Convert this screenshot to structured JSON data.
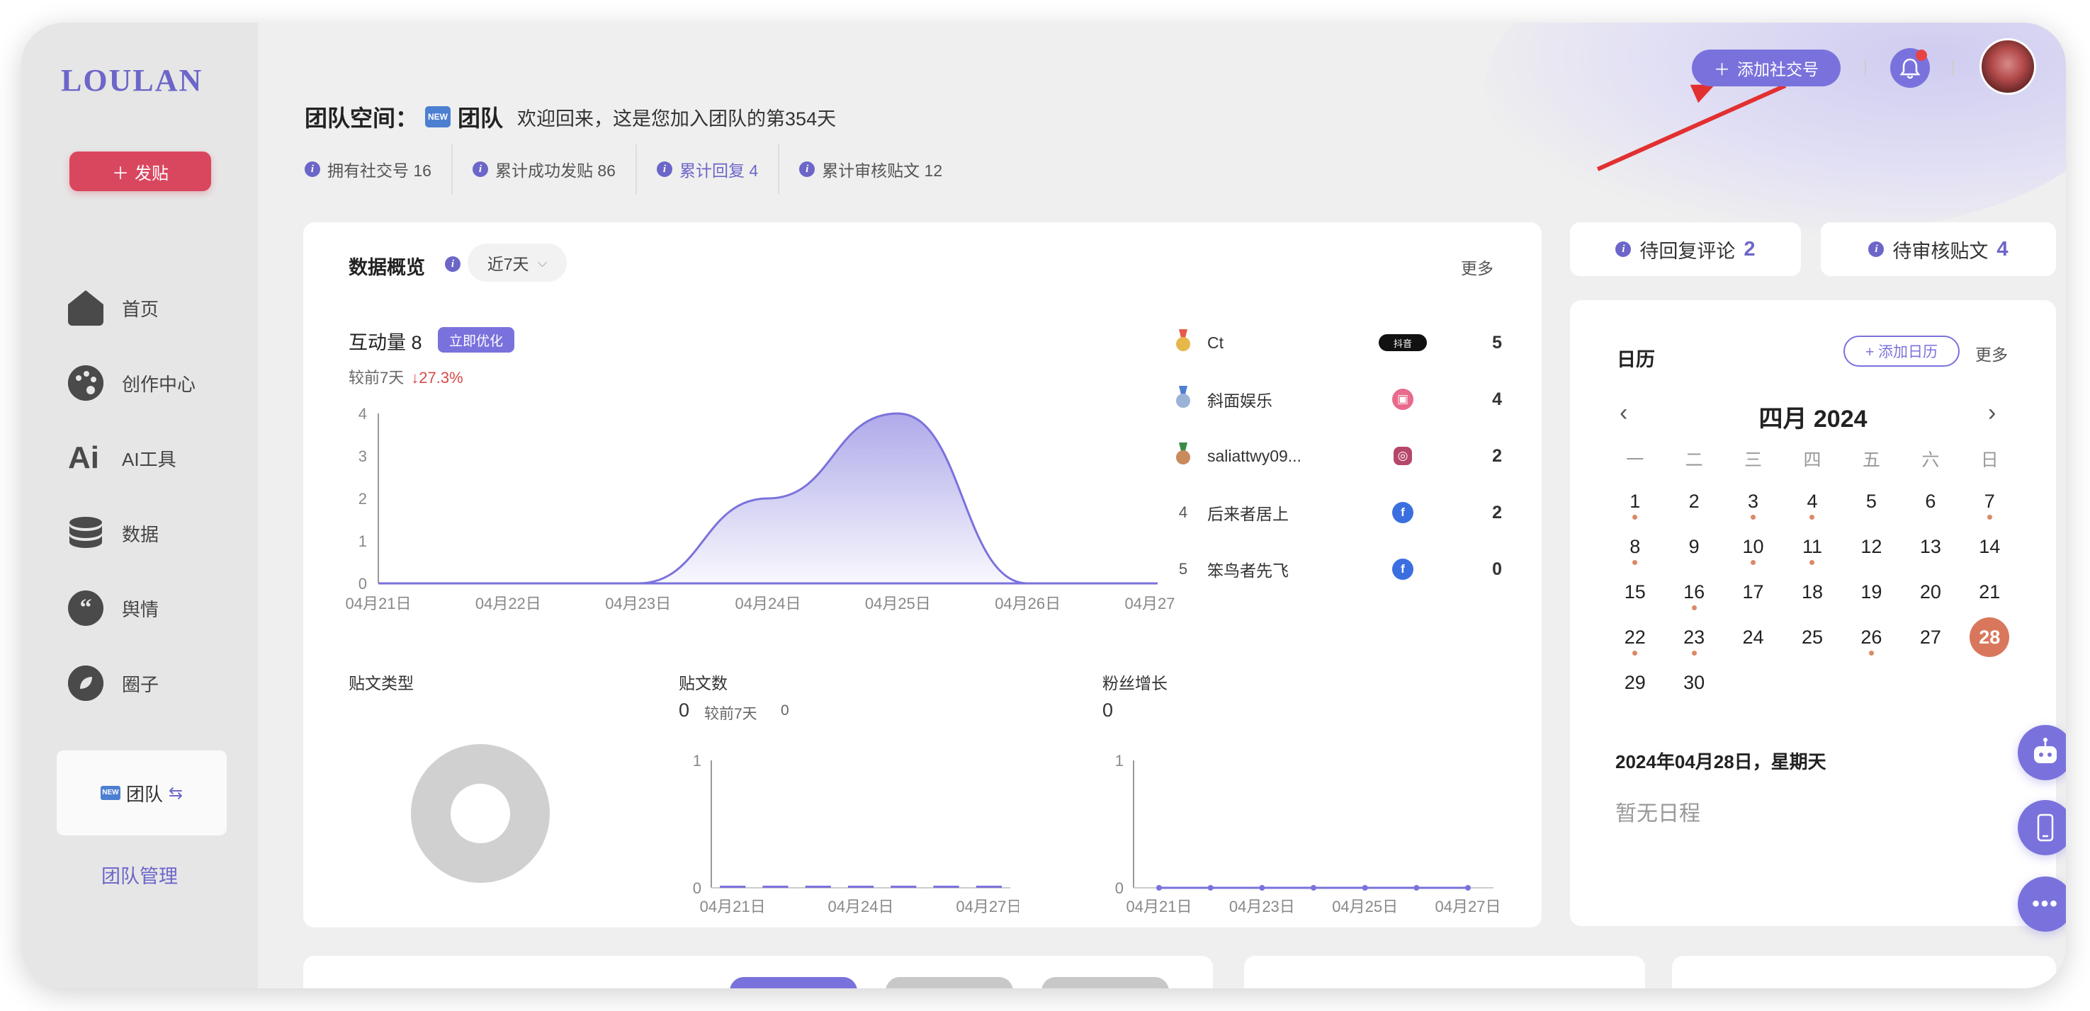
{
  "sidebar": {
    "logo": "LOULAN",
    "post_button": "发贴",
    "nav": [
      {
        "label": "首页",
        "icon": "home-icon"
      },
      {
        "label": "创作中心",
        "icon": "palette-icon"
      },
      {
        "label": "AI工具",
        "icon": "ai-icon"
      },
      {
        "label": "数据",
        "icon": "database-icon"
      },
      {
        "label": "舆情",
        "icon": "quote-icon"
      },
      {
        "label": "圈子",
        "icon": "leaf-icon"
      }
    ],
    "team_badge": "NEW",
    "team_name": "团队",
    "team_manage": "团队管理"
  },
  "header": {
    "title_prefix": "团队空间：",
    "title_badge": "NEW",
    "title_team": "团队",
    "welcome": "欢迎回来，这是您加入团队的第354天",
    "stats": [
      {
        "label": "拥有社交号 16"
      },
      {
        "label": "累计成功发贴 86"
      },
      {
        "label": "累计回复 4"
      },
      {
        "label": "累计审核贴文 12"
      }
    ],
    "add_social": "添加社交号"
  },
  "overview": {
    "title": "数据概览",
    "range": "近7天",
    "more": "更多",
    "interaction_label": "互动量 8",
    "optimize_badge": "立即优化",
    "compare_label": "较前7天",
    "compare_change": "27.3%",
    "ranking": [
      {
        "rank": "1",
        "name": "Ct",
        "platform": "抖音",
        "value": "5",
        "medal": "#e6b84a"
      },
      {
        "rank": "2",
        "name": "斜面娱乐",
        "platform": "bilibili",
        "value": "4",
        "medal": "#9bb3d6"
      },
      {
        "rank": "3",
        "name": "saliattwy09...",
        "platform": "instagram",
        "value": "2",
        "medal": "#c98a5e"
      },
      {
        "rank": "4",
        "name": "后来者居上",
        "platform": "facebook",
        "value": "2"
      },
      {
        "rank": "5",
        "name": "笨鸟者先飞",
        "platform": "facebook",
        "value": "0"
      }
    ],
    "post_type_label": "贴文类型",
    "post_count_label": "贴文数",
    "post_count_value": "0",
    "post_count_compare": "较前7天",
    "post_count_compare_value": "0",
    "fans_label": "粉丝增长",
    "fans_value": "0"
  },
  "chart_data": [
    {
      "type": "area",
      "x": [
        "04月21日",
        "04月22日",
        "04月23日",
        "04月24日",
        "04月25日",
        "04月26日",
        "04月27日"
      ],
      "series": [
        {
          "values": [
            0,
            0,
            0,
            2,
            4,
            0,
            0
          ]
        }
      ],
      "yticks": [
        "0",
        "1",
        "2",
        "3",
        "4"
      ],
      "ylim": [
        0,
        4
      ],
      "color": "#7a72dc"
    },
    {
      "type": "pie",
      "values": [
        1
      ],
      "color": "#d0d0d0"
    },
    {
      "type": "bar",
      "x": [
        "04月21日",
        "04月24日",
        "04月27日"
      ],
      "categories": [
        "1",
        "2",
        "3",
        "4",
        "5",
        "6",
        "7"
      ],
      "values": [
        0,
        0,
        0,
        0,
        0,
        0,
        0
      ],
      "yticks": [
        "0",
        "1"
      ],
      "ylim": [
        0,
        1
      ]
    },
    {
      "type": "line",
      "x": [
        "04月21日",
        "04月23日",
        "04月25日",
        "04月27日"
      ],
      "values": [
        0,
        0,
        0,
        0,
        0,
        0,
        0
      ],
      "yticks": [
        "0",
        "1"
      ],
      "ylim": [
        0,
        1
      ]
    }
  ],
  "right": {
    "pending_comments_label": "待回复评论",
    "pending_comments_value": "2",
    "pending_posts_label": "待审核贴文",
    "pending_posts_value": "4"
  },
  "calendar": {
    "title": "日历",
    "add": "+ 添加日历",
    "more": "更多",
    "month": "四月 2024",
    "weekdays": [
      "一",
      "二",
      "三",
      "四",
      "五",
      "六",
      "日"
    ],
    "days": [
      {
        "d": "1",
        "mark": true
      },
      {
        "d": "2"
      },
      {
        "d": "3",
        "mark": true
      },
      {
        "d": "4",
        "mark": true
      },
      {
        "d": "5"
      },
      {
        "d": "6"
      },
      {
        "d": "7",
        "mark": true
      },
      {
        "d": "8",
        "mark": true
      },
      {
        "d": "9"
      },
      {
        "d": "10",
        "mark": true
      },
      {
        "d": "11",
        "mark": true
      },
      {
        "d": "12"
      },
      {
        "d": "13"
      },
      {
        "d": "14"
      },
      {
        "d": "15"
      },
      {
        "d": "16",
        "mark": true
      },
      {
        "d": "17"
      },
      {
        "d": "18"
      },
      {
        "d": "19"
      },
      {
        "d": "20"
      },
      {
        "d": "21"
      },
      {
        "d": "22",
        "mark": true
      },
      {
        "d": "23",
        "mark": true
      },
      {
        "d": "24"
      },
      {
        "d": "25"
      },
      {
        "d": "26",
        "mark": true
      },
      {
        "d": "27"
      },
      {
        "d": "28",
        "today": true
      },
      {
        "d": "29"
      },
      {
        "d": "30"
      }
    ],
    "selected_date": "2024年04月28日，星期天",
    "empty": "暂无日程"
  }
}
